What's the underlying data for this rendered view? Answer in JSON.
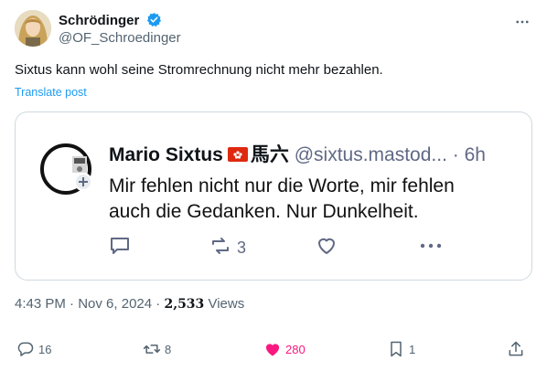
{
  "author": {
    "display_name": "Schrödinger",
    "handle": "@OF_Schroedinger",
    "verified": true
  },
  "tweet": {
    "text": "Sixtus kann wohl seine Stromrechnung nicht mehr bezahlen.",
    "translate_label": "Translate post"
  },
  "quoted_post": {
    "name": "Mario Sixtus",
    "flag": "hong-kong-flag",
    "cjk_name": "馬六",
    "handle": "@sixtus.mastod...",
    "separator": "·",
    "time": "6h",
    "body": "Mir fehlen nicht nur die Worte, mir fehlen auch die Gedanken. Nur Dunkelheit.",
    "boost_count": "3"
  },
  "meta": {
    "time": "4:43 PM",
    "dot": "·",
    "date": "Nov 6, 2024",
    "views_count": "2,533",
    "views_label": "Views"
  },
  "actions": {
    "replies": "16",
    "reposts": "8",
    "likes": "280",
    "bookmarks": "1"
  },
  "colors": {
    "accent": "#1d9bf0",
    "like": "#f91880",
    "muted": "#536471",
    "border": "#cfd9de"
  }
}
